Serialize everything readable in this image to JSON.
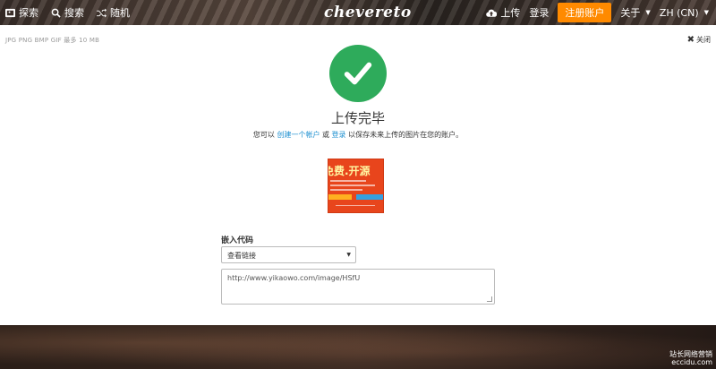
{
  "nav": {
    "explore": "探索",
    "search": "搜索",
    "random": "随机",
    "brand": "chevereto",
    "upload": "上传",
    "login": "登录",
    "signup": "注册账户",
    "about": "关于",
    "language": "ZH (CN)"
  },
  "panel": {
    "formats": "JPG PNG BMP GIF  最多 10 MB",
    "close": "关闭",
    "title": "上传完毕",
    "subtitle": {
      "part1": "您可以 ",
      "create_account": "创建一个帐户",
      "part2": " 或 ",
      "login": "登录",
      "part3": " 以保存未来上传的图片在您的账户。"
    },
    "thumbnail_text": "免费.开源",
    "embed": {
      "label": "嵌入代码",
      "selected_option": "查看链接",
      "code": "http://www.yikaowo.com/image/HSfU"
    }
  },
  "watermark": {
    "line1": "站长网络营销",
    "line2": "eccidu.com"
  },
  "colors": {
    "accent_orange": "#ff8a00",
    "success_green": "#2eab5b",
    "link_blue": "#1e90d0"
  }
}
